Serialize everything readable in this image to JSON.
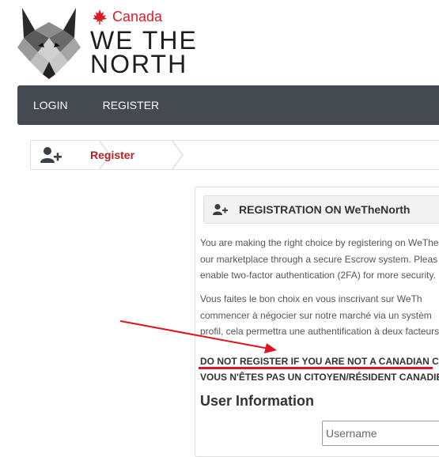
{
  "brand": {
    "country": "Canada",
    "title_line1": "WE THE",
    "title_line2": "NORTH",
    "colors": {
      "red": "#d81e2b",
      "dark": "#1e1e1e"
    }
  },
  "nav": {
    "items": [
      {
        "label": "LOGIN"
      },
      {
        "label": "REGISTER"
      }
    ],
    "bg_color": "#444a50"
  },
  "breadcrumb": {
    "icon": "add-user-icon",
    "current": "Register"
  },
  "panel": {
    "icon": "add-user-icon",
    "title": "REGISTRATION ON WeTheNorth",
    "en_lines": [
      "You are making the right choice by registering on WeThe",
      "our marketplace through a secure Escrow system. Pleas",
      "enable two-factor authentication (2FA) for more security."
    ],
    "fr_lines": [
      "Vous faites le bon choix en vous inscrivant sur WeTh",
      "commencer à négocier sur notre marché via un systèm",
      "profil, cela permettra une authentification à deux facteurs"
    ],
    "warning_en": "DO NOT REGISTER IF YOU ARE NOT A CANADIAN C",
    "warning_fr": "VOUS N'ÊTES PAS UN CITOYEN/RÉSIDENT CANADIE",
    "section_title": "User Information",
    "username_placeholder": "Username"
  }
}
